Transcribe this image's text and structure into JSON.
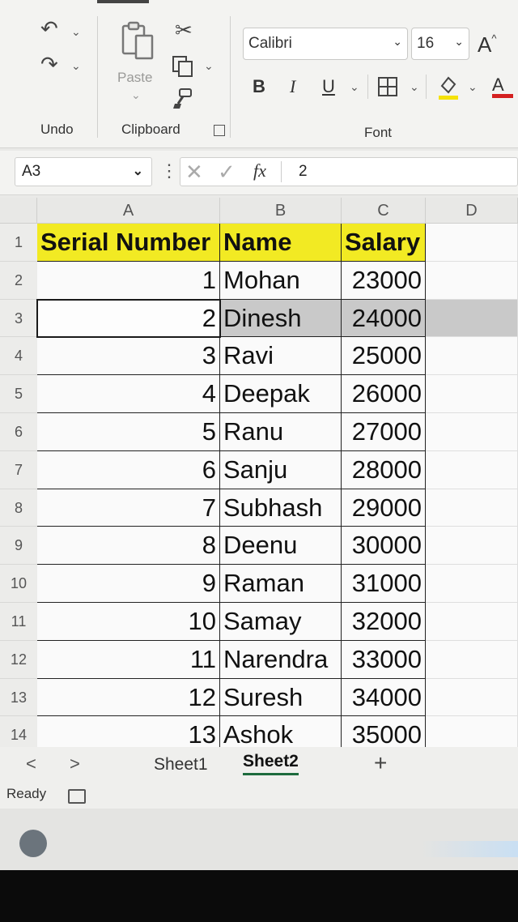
{
  "ribbon": {
    "undo_label": "Undo",
    "paste_label": "Paste",
    "clipboard_label": "Clipboard",
    "font_label": "Font",
    "font_name": "Calibri",
    "font_size": "16",
    "bold": "B",
    "italic": "I",
    "underline": "U",
    "grow_font": "A",
    "font_color": "A",
    "fill_color": "#f5e20a",
    "font_color_value": "#d42020"
  },
  "formula_bar": {
    "cell_ref": "A3",
    "fx": "fx",
    "value": "2"
  },
  "grid": {
    "columns": [
      "A",
      "B",
      "C",
      "D"
    ],
    "row_numbers": [
      "1",
      "2",
      "3",
      "4",
      "5",
      "6",
      "7",
      "8",
      "9",
      "10",
      "11",
      "12",
      "13",
      "14"
    ],
    "header": [
      "Serial Number",
      "Name",
      "Salary"
    ],
    "rows": [
      [
        "1",
        "Mohan",
        "23000"
      ],
      [
        "2",
        "Dinesh",
        "24000"
      ],
      [
        "3",
        "Ravi",
        "25000"
      ],
      [
        "4",
        "Deepak",
        "26000"
      ],
      [
        "5",
        "Ranu",
        "27000"
      ],
      [
        "6",
        "Sanju",
        "28000"
      ],
      [
        "7",
        "Subhash",
        "29000"
      ],
      [
        "8",
        "Deenu",
        "30000"
      ],
      [
        "9",
        "Raman",
        "31000"
      ],
      [
        "10",
        "Samay",
        "32000"
      ],
      [
        "11",
        "Narendra",
        "33000"
      ],
      [
        "12",
        "Suresh",
        "34000"
      ],
      [
        "13",
        "Ashok",
        "35000"
      ]
    ],
    "header_color": "#f2ea23",
    "selected_row_color": "#c8c8c8"
  },
  "sheets": {
    "tabs": [
      "Sheet1",
      "Sheet2"
    ],
    "active": "Sheet2",
    "add_label": "+",
    "prev": "<",
    "next": ">"
  },
  "status": {
    "text": "Ready"
  }
}
